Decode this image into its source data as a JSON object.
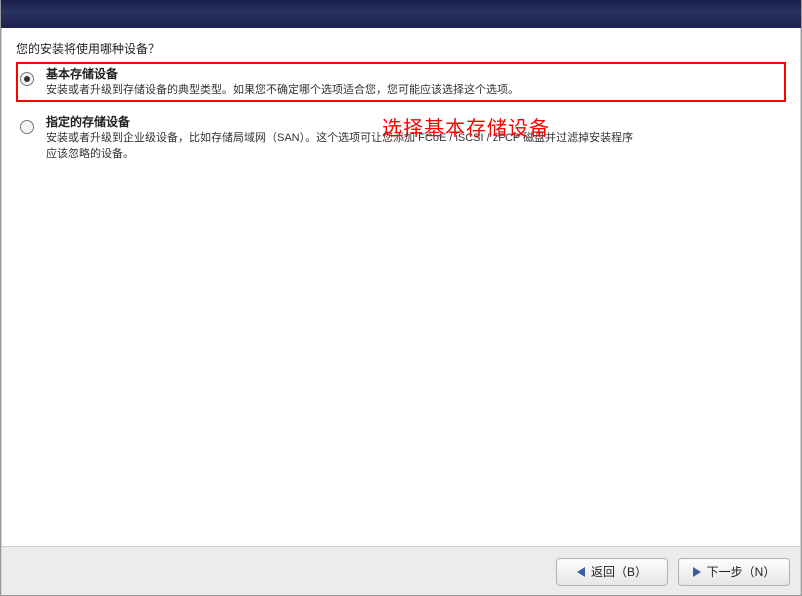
{
  "prompt": "您的安装将使用哪种设备？",
  "options": [
    {
      "title": "基本存储设备",
      "desc": "安装或者升级到存储设备的典型类型。如果您不确定哪个选项适合您，您可能应该选择这个选项。",
      "selected": true
    },
    {
      "title": "指定的存储设备",
      "desc_line1": "安装或者升级到企业级设备，比如存储局域网（SAN）。这个选项可让您添加 FCoE / iSCSI / zFCP 磁盘并过滤掉安装程序",
      "desc_line2": "应该忽略的设备。",
      "selected": false
    }
  ],
  "annotation": "选择基本存储设备",
  "buttons": {
    "back": "返回（B）",
    "next": "下一步（N）"
  }
}
